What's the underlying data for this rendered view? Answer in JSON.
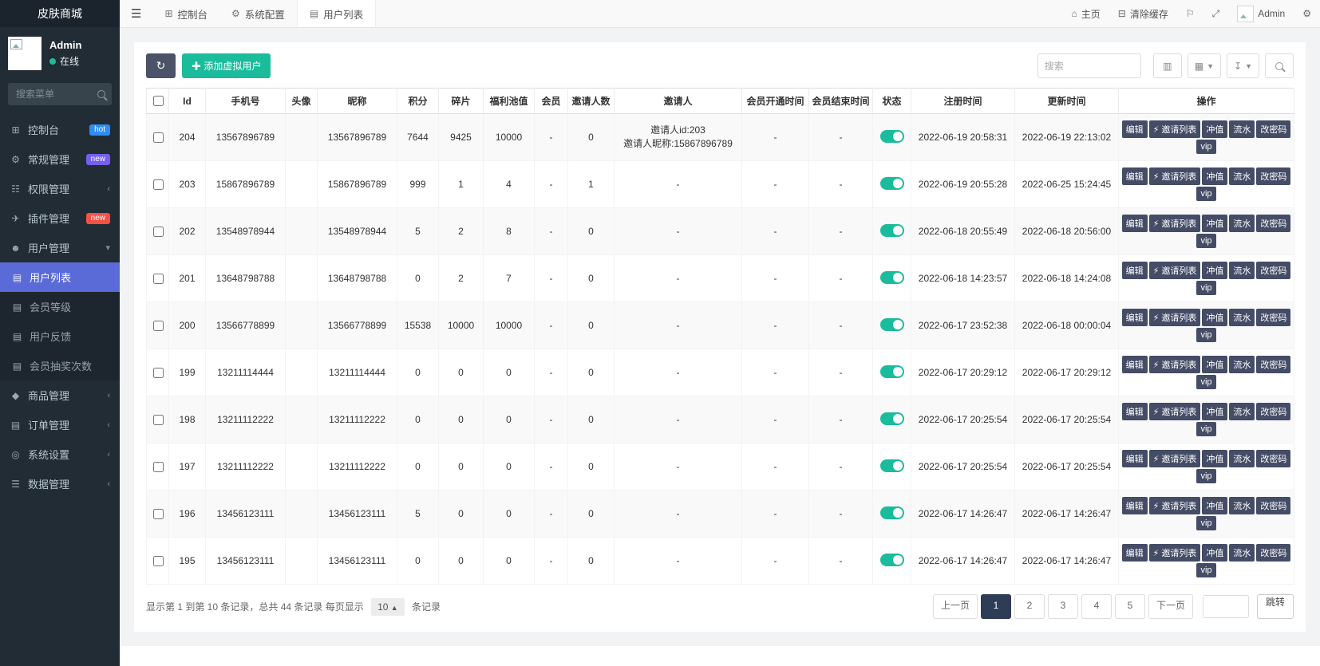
{
  "app": {
    "title": "皮肤商城"
  },
  "user": {
    "name": "Admin",
    "status": "在线"
  },
  "colors": {
    "accent_green": "#1abc9c",
    "active_blue": "#5a6bd8",
    "dark_button": "#454c66",
    "badge_hot_blue": "#2d8ef5",
    "badge_new_purple": "#7460ee",
    "badge_new_red": "#f75145"
  },
  "sidebar": {
    "search_placeholder": "搜索菜单",
    "items": [
      {
        "key": "console",
        "label": "控制台",
        "icon": "dashboard-icon",
        "glyph": "⊞",
        "badge": "hot",
        "badge_color": "#2d8ef5"
      },
      {
        "key": "general",
        "label": "常规管理",
        "icon": "gear-icon",
        "glyph": "⚙",
        "badge": "new",
        "badge_color": "#7460ee"
      },
      {
        "key": "permissions",
        "label": "权限管理",
        "icon": "permissions-icon",
        "glyph": "☷",
        "chevron": "left"
      },
      {
        "key": "plugins",
        "label": "插件管理",
        "icon": "plugin-icon",
        "glyph": "✈",
        "badge": "new",
        "badge_color": "#f75145"
      },
      {
        "key": "users",
        "label": "用户管理",
        "icon": "user-icon",
        "glyph": "☻",
        "chevron": "down",
        "children": [
          {
            "key": "user-list",
            "label": "用户列表",
            "active": true
          },
          {
            "key": "member-level",
            "label": "会员等级"
          },
          {
            "key": "user-feedback",
            "label": "用户反馈"
          },
          {
            "key": "member-lottery-count",
            "label": "会员抽奖次数"
          }
        ]
      },
      {
        "key": "products",
        "label": "商品管理",
        "icon": "products-icon",
        "glyph": "◆",
        "chevron": "left"
      },
      {
        "key": "orders",
        "label": "订单管理",
        "icon": "orders-icon",
        "glyph": "▤",
        "chevron": "left"
      },
      {
        "key": "system-settings",
        "label": "系统设置",
        "icon": "settings-icon",
        "glyph": "◎",
        "chevron": "left"
      },
      {
        "key": "data",
        "label": "数据管理",
        "icon": "database-icon",
        "glyph": "☰",
        "chevron": "left"
      }
    ]
  },
  "navbar": {
    "tabs": [
      {
        "key": "console",
        "label": "控制台",
        "icon": "dashboard-icon",
        "glyph": "⊞"
      },
      {
        "key": "system-config",
        "label": "系统配置",
        "icon": "gear-icon",
        "glyph": "⚙"
      },
      {
        "key": "user-list",
        "label": "用户列表",
        "icon": "list-icon",
        "glyph": "▤",
        "active": true
      }
    ],
    "home_label": "主页",
    "clear_cache_label": "清除缓存",
    "user_label": "Admin"
  },
  "toolbar": {
    "add_user_label": "添加虚拟用户",
    "search_placeholder": "搜索"
  },
  "table": {
    "headers": [
      "Id",
      "手机号",
      "头像",
      "昵称",
      "积分",
      "碎片",
      "福利池值",
      "会员",
      "邀请人数",
      "邀请人",
      "会员开通时间",
      "会员结束时间",
      "状态",
      "注册时间",
      "更新时间",
      "操作"
    ],
    "actions": [
      {
        "key": "edit",
        "label": "编辑"
      },
      {
        "key": "invite-list",
        "label": "邀请列表",
        "icon": "lightning-icon",
        "glyph": "⚡"
      },
      {
        "key": "recharge",
        "label": "冲值"
      },
      {
        "key": "flow",
        "label": "流水"
      },
      {
        "key": "change-password",
        "label": "改密码"
      },
      {
        "key": "vip",
        "label": "vip"
      }
    ],
    "rows": [
      {
        "id": "204",
        "phone": "13567896789",
        "avatar": "",
        "nickname": "13567896789",
        "points": "7644",
        "fragments": "9425",
        "pool": "10000",
        "member": "-",
        "invite_count": "0",
        "inviter": [
          "邀请人id:203",
          "邀请人昵称:15867896789"
        ],
        "member_start": "-",
        "member_end": "-",
        "status_on": true,
        "register_time": "2022-06-19 20:58:31",
        "update_time": "2022-06-19 22:13:02"
      },
      {
        "id": "203",
        "phone": "15867896789",
        "avatar": "",
        "nickname": "15867896789",
        "points": "999",
        "fragments": "1",
        "pool": "4",
        "member": "-",
        "invite_count": "1",
        "inviter": "-",
        "member_start": "-",
        "member_end": "-",
        "status_on": true,
        "register_time": "2022-06-19 20:55:28",
        "update_time": "2022-06-25 15:24:45"
      },
      {
        "id": "202",
        "phone": "13548978944",
        "avatar": "",
        "nickname": "13548978944",
        "points": "5",
        "fragments": "2",
        "pool": "8",
        "member": "-",
        "invite_count": "0",
        "inviter": "-",
        "member_start": "-",
        "member_end": "-",
        "status_on": true,
        "register_time": "2022-06-18 20:55:49",
        "update_time": "2022-06-18 20:56:00"
      },
      {
        "id": "201",
        "phone": "13648798788",
        "avatar": "",
        "nickname": "13648798788",
        "points": "0",
        "fragments": "2",
        "pool": "7",
        "member": "-",
        "invite_count": "0",
        "inviter": "-",
        "member_start": "-",
        "member_end": "-",
        "status_on": true,
        "register_time": "2022-06-18 14:23:57",
        "update_time": "2022-06-18 14:24:08"
      },
      {
        "id": "200",
        "phone": "13566778899",
        "avatar": "",
        "nickname": "13566778899",
        "points": "15538",
        "fragments": "10000",
        "pool": "10000",
        "member": "-",
        "invite_count": "0",
        "inviter": "-",
        "member_start": "-",
        "member_end": "-",
        "status_on": true,
        "register_time": "2022-06-17 23:52:38",
        "update_time": "2022-06-18 00:00:04"
      },
      {
        "id": "199",
        "phone": "13211114444",
        "avatar": "",
        "nickname": "13211114444",
        "points": "0",
        "fragments": "0",
        "pool": "0",
        "member": "-",
        "invite_count": "0",
        "inviter": "-",
        "member_start": "-",
        "member_end": "-",
        "status_on": true,
        "register_time": "2022-06-17 20:29:12",
        "update_time": "2022-06-17 20:29:12"
      },
      {
        "id": "198",
        "phone": "13211112222",
        "avatar": "",
        "nickname": "13211112222",
        "points": "0",
        "fragments": "0",
        "pool": "0",
        "member": "-",
        "invite_count": "0",
        "inviter": "-",
        "member_start": "-",
        "member_end": "-",
        "status_on": true,
        "register_time": "2022-06-17 20:25:54",
        "update_time": "2022-06-17 20:25:54"
      },
      {
        "id": "197",
        "phone": "13211112222",
        "avatar": "",
        "nickname": "13211112222",
        "points": "0",
        "fragments": "0",
        "pool": "0",
        "member": "-",
        "invite_count": "0",
        "inviter": "-",
        "member_start": "-",
        "member_end": "-",
        "status_on": true,
        "register_time": "2022-06-17 20:25:54",
        "update_time": "2022-06-17 20:25:54"
      },
      {
        "id": "196",
        "phone": "13456123111",
        "avatar": "",
        "nickname": "13456123111",
        "points": "5",
        "fragments": "0",
        "pool": "0",
        "member": "-",
        "invite_count": "0",
        "inviter": "-",
        "member_start": "-",
        "member_end": "-",
        "status_on": true,
        "register_time": "2022-06-17 14:26:47",
        "update_time": "2022-06-17 14:26:47"
      },
      {
        "id": "195",
        "phone": "13456123111",
        "avatar": "",
        "nickname": "13456123111",
        "points": "0",
        "fragments": "0",
        "pool": "0",
        "member": "-",
        "invite_count": "0",
        "inviter": "-",
        "member_start": "-",
        "member_end": "-",
        "status_on": true,
        "register_time": "2022-06-17 14:26:47",
        "update_time": "2022-06-17 14:26:47"
      }
    ]
  },
  "footer": {
    "summary_prefix": "显示第 1 到第 10 条记录，总共 44 条记录 每页显示",
    "page_size": "10",
    "summary_suffix": "条记录",
    "prev_label": "上一页",
    "pages": [
      "1",
      "2",
      "3",
      "4",
      "5"
    ],
    "active_page": "1",
    "next_label": "下一页",
    "jump_label": "跳转"
  }
}
